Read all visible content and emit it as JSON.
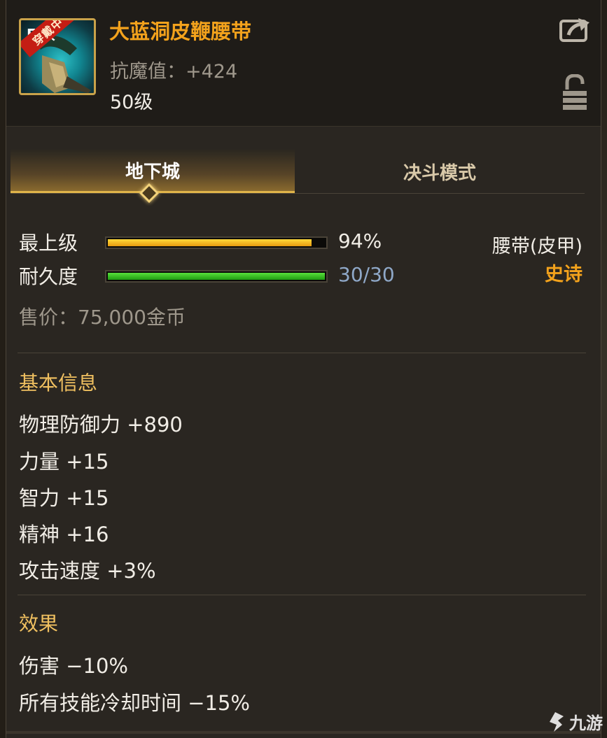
{
  "item": {
    "name": "大蓝洞皮鞭腰带",
    "stat": "抗魔值：+424",
    "level": "50级",
    "badge": "穿戴中",
    "grade_stub": "F 级"
  },
  "tabs": [
    {
      "label": "地下城",
      "active": true
    },
    {
      "label": "决斗模式",
      "active": false
    }
  ],
  "bars": {
    "grade": {
      "label": "最上级",
      "value_text": "94%",
      "fraction": 0.94,
      "color": "#f0a81c"
    },
    "durability": {
      "label": "耐久度",
      "value_text": "30/30",
      "fraction": 1.0,
      "color": "#36c12a",
      "text_color": "#8fa8c8"
    }
  },
  "item_type": "腰带(皮甲)",
  "rarity": "史诗",
  "price": "售价：75,000金币",
  "basic_info": {
    "title": "基本信息",
    "lines": [
      "物理防御力 +890",
      "力量 +15",
      "智力 +15",
      "精神 +16",
      "攻击速度 +3%"
    ]
  },
  "effects": {
    "title": "效果",
    "lines": [
      "伤害 −10%",
      "所有技能冷却时间 −15%"
    ]
  },
  "watermark": "九游",
  "colors": {
    "name": "#f3a21c",
    "rarity": "#f3a21c",
    "section_title": "#f0c060",
    "accent_gold": "#e0b44a"
  }
}
